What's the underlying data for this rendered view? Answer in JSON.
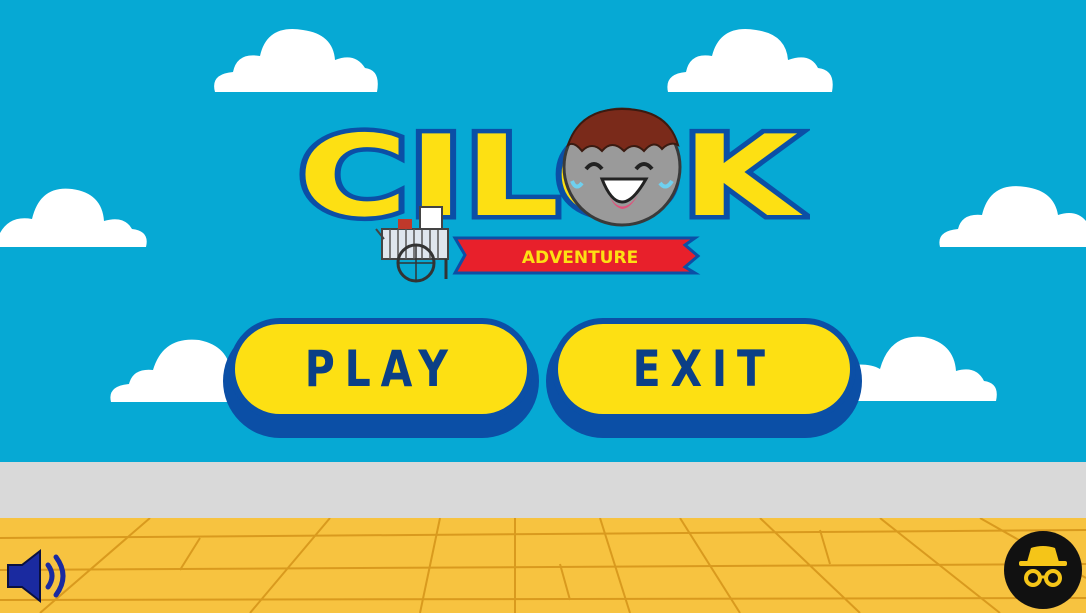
{
  "game": {
    "title_main": "CILOK",
    "title_sub": "ADVENTURE"
  },
  "menu": {
    "play_label": "PLAY",
    "exit_label": "EXIT"
  },
  "controls": {
    "sound_icon": "speaker-volume-icon",
    "secondary_icon": "incognito-icon"
  },
  "colors": {
    "sky": "#06a9d4",
    "button_fill": "#fde013",
    "button_border": "#0b4fa6",
    "title_yellow": "#fde013",
    "title_outline": "#0b4fa6",
    "ribbon_red": "#e8202b",
    "floor": "#f7c340",
    "wall": "#d9d9d9"
  }
}
